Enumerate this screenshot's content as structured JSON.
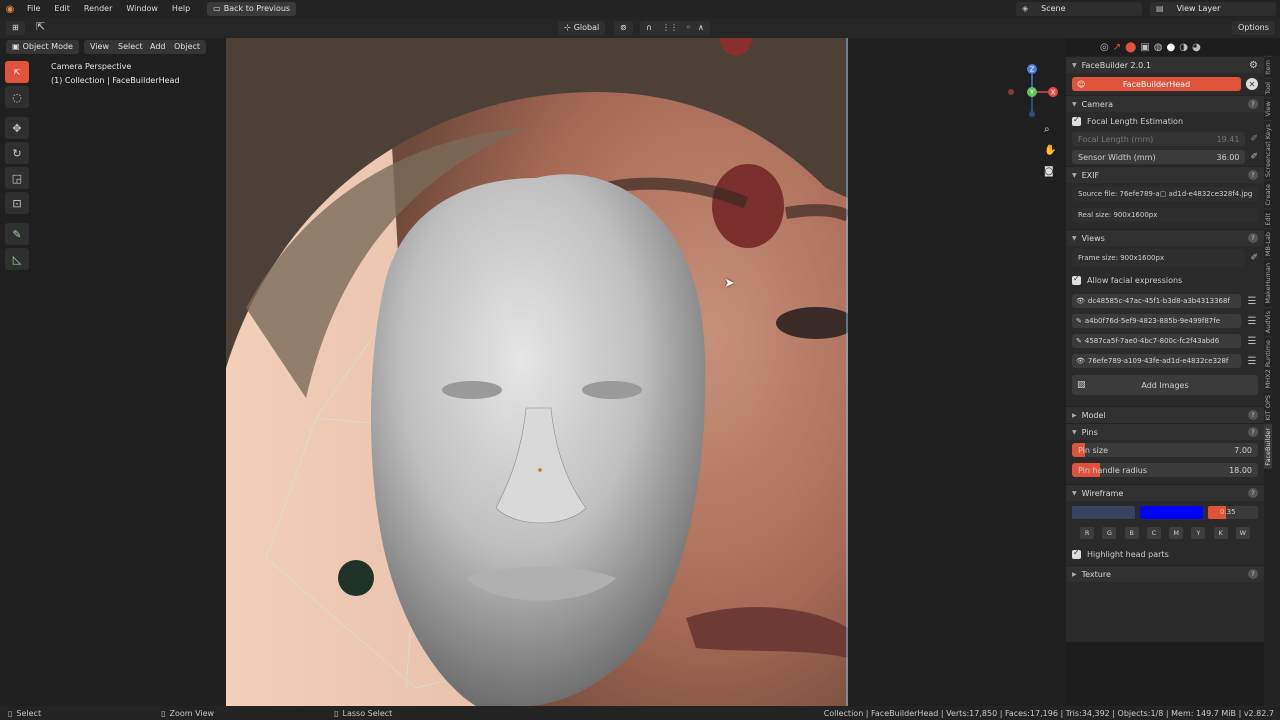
{
  "menu": {
    "items": [
      "File",
      "Edit",
      "Render",
      "Window",
      "Help"
    ],
    "back_label": "Back to Previous",
    "scene": "Scene",
    "view_layer": "View Layer"
  },
  "header": {
    "transform": "Global",
    "options": "Options"
  },
  "viewport_header": {
    "mode": "Object Mode",
    "menus": [
      "View",
      "Select",
      "Add",
      "Object"
    ]
  },
  "overlay_text": {
    "line1": "Camera Perspective",
    "line2": "(1) Collection | FaceBuilderHead"
  },
  "gizmo": {
    "x": "X",
    "y": "Y",
    "z": "Z"
  },
  "panel": {
    "title": "FaceBuilder 2.0.1",
    "head_button": "FaceBuilderHead",
    "camera": {
      "title": "Camera",
      "focal_estimation": "Focal Length Estimation",
      "focal_length_label": "Focal Length (mm)",
      "focal_length_value": "19.41",
      "sensor_width_label": "Sensor Width (mm)",
      "sensor_width_value": "36.00"
    },
    "exif": {
      "title": "EXIF",
      "source_file": "Source file: 76efe789-a▢ ad1d-e4832ce328f4.jpg",
      "real_size": "Real size: 900x1600px"
    },
    "views": {
      "title": "Views",
      "frame_size": "Frame size: 900x1600px",
      "allow_expressions": "Allow facial expressions",
      "items": [
        "dc48585c-47ac-45f1-b3d8-a3b4313368f",
        "a4b0f76d-5ef9-4823-885b-9e499f87fe",
        "4587ca5f-7ae0-4bc7-800c-fc2f43abd6",
        "76efe789-a109-43fe-ad1d-e4832ce328f"
      ],
      "add_images": "Add Images"
    },
    "model": {
      "title": "Model"
    },
    "pins": {
      "title": "Pins",
      "pin_size_label": "Pin size",
      "pin_size_value": "7.00",
      "pin_radius_label": "Pin handle radius",
      "pin_radius_value": "18.00"
    },
    "wireframe": {
      "title": "Wireframe",
      "opacity": "0.35",
      "keys": [
        "R",
        "G",
        "B",
        "C",
        "M",
        "Y",
        "K",
        "W"
      ],
      "highlight": "Highlight head parts"
    },
    "texture": {
      "title": "Texture"
    }
  },
  "side_tabs": [
    "Item",
    "Tool",
    "View",
    "Screencast Keys",
    "Create",
    "Edit",
    "MB-Lab",
    "MakeHuman",
    "AudVis",
    "MHX2 Runtime",
    "KIT OPS",
    "FaceBuilder"
  ],
  "status": {
    "select": "Select",
    "zoom": "Zoom View",
    "lasso": "Lasso Select",
    "stats": "Collection | FaceBuilderHead | Verts:17,850 | Faces:17,196 | Tris:34,392 | Objects:1/8 | Mem: 149.7 MiB | v2.82.7"
  },
  "colors": {
    "accent_red": "#e0533a",
    "wire_blue": "#0000ff",
    "wire_dark": "#3b4160"
  }
}
